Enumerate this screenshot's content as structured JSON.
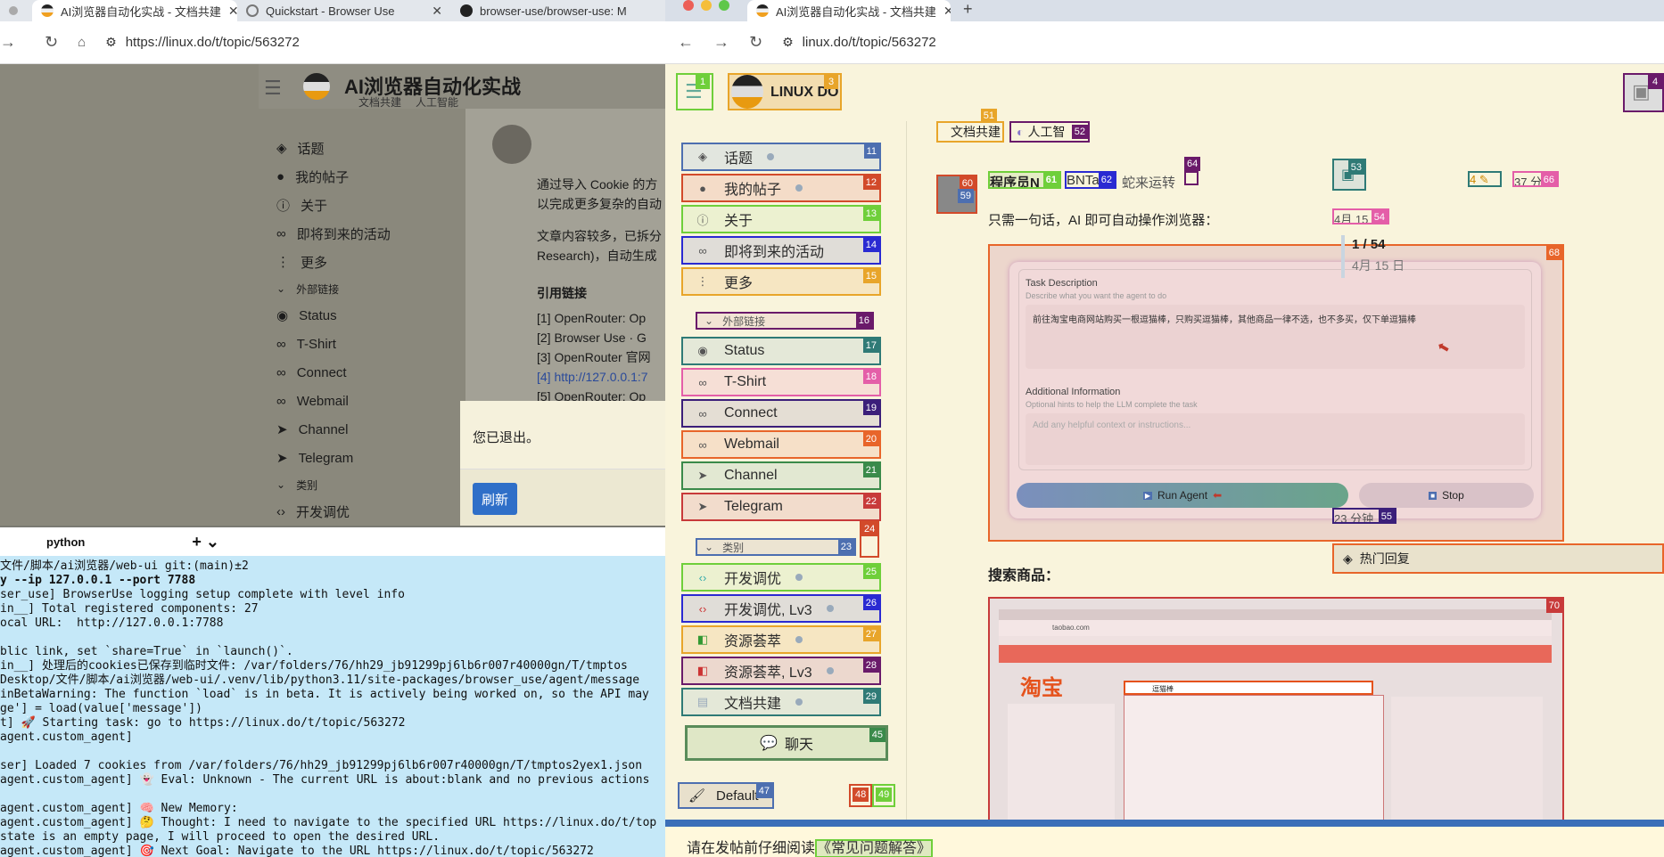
{
  "left_window": {
    "tabs": [
      {
        "label": "AI浏览器自动化实战 - 文档共建"
      },
      {
        "label": "Quickstart - Browser Use"
      },
      {
        "label": "browser-use/browser-use: M"
      }
    ],
    "url": "https://linux.do/t/topic/563272",
    "topic_title": "AI浏览器自动化实战",
    "topic_tags": [
      "文档共建",
      "人工智能"
    ],
    "sidebar": [
      "话题",
      "我的帖子",
      "关于",
      "即将到来的活动",
      "更多"
    ],
    "external_links_label": "外部链接",
    "external_links": [
      "Status",
      "T-Shirt",
      "Connect",
      "Webmail",
      "Channel",
      "Telegram"
    ],
    "categories_label": "类别",
    "category_first": "开发调优",
    "post_lines": [
      "通过导入 Cookie 的方",
      "以完成更多复杂的自动",
      "文章内容较多，已拆分",
      "Research)，自动生成"
    ],
    "refs_label": "引用链接",
    "refs": [
      "[1] OpenRouter: Op",
      "[2] Browser Use · G",
      "[3] OpenRouter 官网",
      "[4] http://127.0.0.1:7",
      "[5] OpenRouter: Op"
    ],
    "dialog_text": "您已退出。",
    "dialog_button": "刷新",
    "terminal": {
      "tab_label": "python",
      "lines": [
        "文件/脚本/ai浏览器/web-ui git:(main)±2",
        "y --ip 127.0.0.1 --port 7788",
        "ser_use] BrowserUse logging setup complete with level info",
        "in__] Total registered components: 27",
        "ocal URL:  http://127.0.0.1:7788",
        "",
        "blic link, set `share=True` in `launch()`.",
        "in__] 处理后的cookies已保存到临时文件: /var/folders/76/hh29_jb91299pj6lb6r007r40000gn/T/tmptos",
        "Desktop/文件/脚本/ai浏览器/web-ui/.venv/lib/python3.11/site-packages/browser_use/agent/message",
        "inBetaWarning: The function `load` is in beta. It is actively being worked on, so the API may",
        "ge'] = load(value['message'])",
        "t] 🚀 Starting task: go to https://linux.do/t/topic/563272",
        "agent.custom_agent]",
        "",
        "ser] Loaded 7 cookies from /var/folders/76/hh29_jb91299pj6lb6r007r40000gn/T/tmptos2yex1.json",
        "agent.custom_agent] 👻 Eval: Unknown - The current URL is about:blank and no previous actions",
        "",
        "agent.custom_agent] 🧠 New Memory:",
        "agent.custom_agent] 🤔 Thought: I need to navigate to the specified URL https://linux.do/t/top",
        "state is an empty page, I will proceed to open the desired URL.",
        "agent.custom_agent] 🎯 Next Goal: Navigate to the URL https://linux.do/t/topic/563272"
      ]
    }
  },
  "right_window": {
    "tab_label": "AI浏览器自动化实战 - 文档共建",
    "url": "linux.do/t/topic/563272",
    "logo_text": "LINUX DO",
    "tags": [
      "文档共建",
      "人工智"
    ],
    "sidebar": [
      {
        "label": "话题",
        "badge": "11",
        "color": "#4d6fb0"
      },
      {
        "label": "我的帖子",
        "badge": "12",
        "color": "#d24a2a"
      },
      {
        "label": "关于",
        "badge": "13",
        "color": "#6fcf3a"
      },
      {
        "label": "即将到来的活动",
        "badge": "14",
        "color": "#2a2ad2"
      },
      {
        "label": "更多",
        "badge": "15",
        "color": "#e8a52a"
      }
    ],
    "external_label": "外部链接",
    "external_badge": "16",
    "external_links": [
      {
        "label": "Status",
        "badge": "17",
        "color": "#2f7a76"
      },
      {
        "label": "T-Shirt",
        "badge": "18",
        "color": "#e45ea8"
      },
      {
        "label": "Connect",
        "badge": "19",
        "color": "#3b1f7a"
      },
      {
        "label": "Webmail",
        "badge": "20",
        "color": "#e8652a"
      },
      {
        "label": "Channel",
        "badge": "21",
        "color": "#3a8a4a"
      },
      {
        "label": "Telegram",
        "badge": "22",
        "color": "#c83a3a"
      }
    ],
    "category_label": "类别",
    "category_badge": "23",
    "categories": [
      {
        "label": "开发调优",
        "badge": "25",
        "color": "#6fcf3a"
      },
      {
        "label": "开发调优, Lv3",
        "badge": "26",
        "color": "#2a2ad2"
      },
      {
        "label": "资源荟萃",
        "badge": "27",
        "color": "#e8a52a"
      },
      {
        "label": "资源荟萃, Lv3",
        "badge": "28",
        "color": "#6a1a6a"
      },
      {
        "label": "文档共建",
        "badge": "29",
        "color": "#2f7a76"
      }
    ],
    "chat_button": "聊天",
    "theme_button": "Default",
    "post": {
      "author": "程序员N",
      "meta1": "BNTa",
      "meta2": "蛇来运转",
      "intro": "只需一句话，AI 即可自动操作浏览器：",
      "search_heading": "搜索商品：",
      "task_label": "Task Description",
      "task_hint": "Describe what you want the agent to do",
      "task_text": "前往淘宝电商网站购买一根逗猫棒，只购买逗猫棒，其他商品一律不选，也不多买，仅下单逗猫棒",
      "add_label": "Additional Information",
      "add_hint": "Optional hints to help the LLM complete the task",
      "add_placeholder": "Add any helpful context or instructions...",
      "run_button": "Run Agent",
      "stop_button": "Stop",
      "taobao_url": "taobao.com",
      "taobao_logo": "淘宝",
      "taobao_search": "逗猫棒"
    },
    "timeline": {
      "date_top": "4月 15",
      "progress": "1 / 54",
      "date_sub": "4月 15 日",
      "ago": "23 分钟",
      "hot_button": "热门回复"
    },
    "stats": {
      "likes": "4",
      "time": "37 分"
    },
    "footer_text": "请在发帖前仔细阅读",
    "footer_link": "《常见问题解答》"
  }
}
